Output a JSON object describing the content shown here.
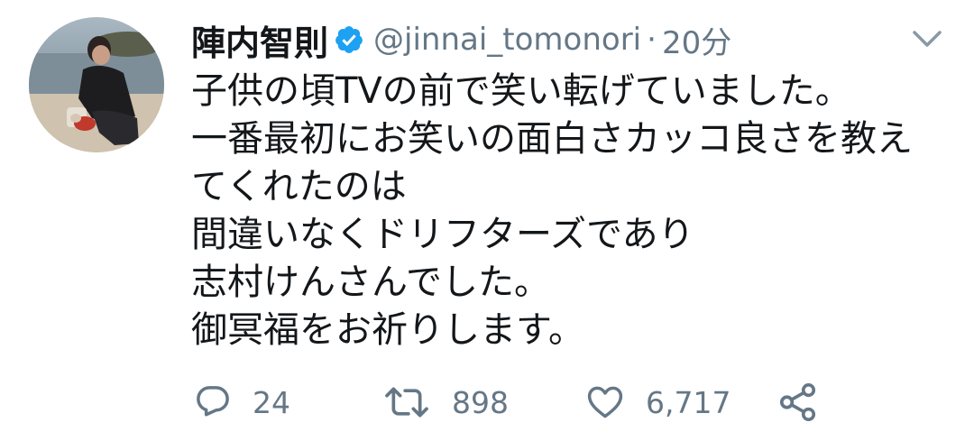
{
  "user": {
    "display_name": "陣内智則",
    "handle": "@jinnai_tomonori",
    "separator": "·",
    "time": "20分"
  },
  "tweet": {
    "lines": [
      "子供の頃TVの前で笑い転げていました。",
      "一番最初にお笑いの面白さカッコ良さを教え",
      "てくれたのは",
      "間違いなくドリフターズであり",
      "志村けんさんでした。",
      "御冥福をお祈りします。"
    ]
  },
  "actions": {
    "replies": "24",
    "retweets": "898",
    "likes": "6,717"
  },
  "colors": {
    "verified": "#1da1f2",
    "muted": "#657786",
    "text": "#14171a"
  },
  "icons": [
    "reply-icon",
    "retweet-icon",
    "like-icon",
    "share-icon",
    "verified-icon",
    "chevron-down-icon"
  ]
}
